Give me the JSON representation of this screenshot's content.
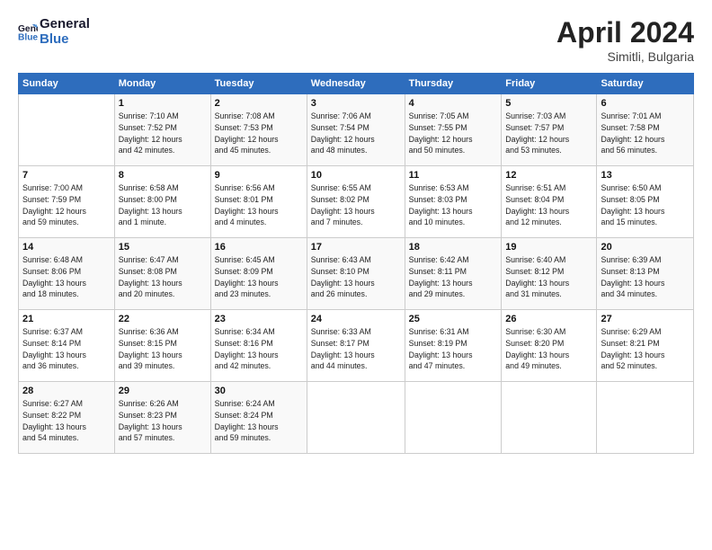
{
  "header": {
    "logo_line1": "General",
    "logo_line2": "Blue",
    "month": "April 2024",
    "location": "Simitli, Bulgaria"
  },
  "weekdays": [
    "Sunday",
    "Monday",
    "Tuesday",
    "Wednesday",
    "Thursday",
    "Friday",
    "Saturday"
  ],
  "weeks": [
    [
      {
        "day": "",
        "info": ""
      },
      {
        "day": "1",
        "info": "Sunrise: 7:10 AM\nSunset: 7:52 PM\nDaylight: 12 hours\nand 42 minutes."
      },
      {
        "day": "2",
        "info": "Sunrise: 7:08 AM\nSunset: 7:53 PM\nDaylight: 12 hours\nand 45 minutes."
      },
      {
        "day": "3",
        "info": "Sunrise: 7:06 AM\nSunset: 7:54 PM\nDaylight: 12 hours\nand 48 minutes."
      },
      {
        "day": "4",
        "info": "Sunrise: 7:05 AM\nSunset: 7:55 PM\nDaylight: 12 hours\nand 50 minutes."
      },
      {
        "day": "5",
        "info": "Sunrise: 7:03 AM\nSunset: 7:57 PM\nDaylight: 12 hours\nand 53 minutes."
      },
      {
        "day": "6",
        "info": "Sunrise: 7:01 AM\nSunset: 7:58 PM\nDaylight: 12 hours\nand 56 minutes."
      }
    ],
    [
      {
        "day": "7",
        "info": "Sunrise: 7:00 AM\nSunset: 7:59 PM\nDaylight: 12 hours\nand 59 minutes."
      },
      {
        "day": "8",
        "info": "Sunrise: 6:58 AM\nSunset: 8:00 PM\nDaylight: 13 hours\nand 1 minute."
      },
      {
        "day": "9",
        "info": "Sunrise: 6:56 AM\nSunset: 8:01 PM\nDaylight: 13 hours\nand 4 minutes."
      },
      {
        "day": "10",
        "info": "Sunrise: 6:55 AM\nSunset: 8:02 PM\nDaylight: 13 hours\nand 7 minutes."
      },
      {
        "day": "11",
        "info": "Sunrise: 6:53 AM\nSunset: 8:03 PM\nDaylight: 13 hours\nand 10 minutes."
      },
      {
        "day": "12",
        "info": "Sunrise: 6:51 AM\nSunset: 8:04 PM\nDaylight: 13 hours\nand 12 minutes."
      },
      {
        "day": "13",
        "info": "Sunrise: 6:50 AM\nSunset: 8:05 PM\nDaylight: 13 hours\nand 15 minutes."
      }
    ],
    [
      {
        "day": "14",
        "info": "Sunrise: 6:48 AM\nSunset: 8:06 PM\nDaylight: 13 hours\nand 18 minutes."
      },
      {
        "day": "15",
        "info": "Sunrise: 6:47 AM\nSunset: 8:08 PM\nDaylight: 13 hours\nand 20 minutes."
      },
      {
        "day": "16",
        "info": "Sunrise: 6:45 AM\nSunset: 8:09 PM\nDaylight: 13 hours\nand 23 minutes."
      },
      {
        "day": "17",
        "info": "Sunrise: 6:43 AM\nSunset: 8:10 PM\nDaylight: 13 hours\nand 26 minutes."
      },
      {
        "day": "18",
        "info": "Sunrise: 6:42 AM\nSunset: 8:11 PM\nDaylight: 13 hours\nand 29 minutes."
      },
      {
        "day": "19",
        "info": "Sunrise: 6:40 AM\nSunset: 8:12 PM\nDaylight: 13 hours\nand 31 minutes."
      },
      {
        "day": "20",
        "info": "Sunrise: 6:39 AM\nSunset: 8:13 PM\nDaylight: 13 hours\nand 34 minutes."
      }
    ],
    [
      {
        "day": "21",
        "info": "Sunrise: 6:37 AM\nSunset: 8:14 PM\nDaylight: 13 hours\nand 36 minutes."
      },
      {
        "day": "22",
        "info": "Sunrise: 6:36 AM\nSunset: 8:15 PM\nDaylight: 13 hours\nand 39 minutes."
      },
      {
        "day": "23",
        "info": "Sunrise: 6:34 AM\nSunset: 8:16 PM\nDaylight: 13 hours\nand 42 minutes."
      },
      {
        "day": "24",
        "info": "Sunrise: 6:33 AM\nSunset: 8:17 PM\nDaylight: 13 hours\nand 44 minutes."
      },
      {
        "day": "25",
        "info": "Sunrise: 6:31 AM\nSunset: 8:19 PM\nDaylight: 13 hours\nand 47 minutes."
      },
      {
        "day": "26",
        "info": "Sunrise: 6:30 AM\nSunset: 8:20 PM\nDaylight: 13 hours\nand 49 minutes."
      },
      {
        "day": "27",
        "info": "Sunrise: 6:29 AM\nSunset: 8:21 PM\nDaylight: 13 hours\nand 52 minutes."
      }
    ],
    [
      {
        "day": "28",
        "info": "Sunrise: 6:27 AM\nSunset: 8:22 PM\nDaylight: 13 hours\nand 54 minutes."
      },
      {
        "day": "29",
        "info": "Sunrise: 6:26 AM\nSunset: 8:23 PM\nDaylight: 13 hours\nand 57 minutes."
      },
      {
        "day": "30",
        "info": "Sunrise: 6:24 AM\nSunset: 8:24 PM\nDaylight: 13 hours\nand 59 minutes."
      },
      {
        "day": "",
        "info": ""
      },
      {
        "day": "",
        "info": ""
      },
      {
        "day": "",
        "info": ""
      },
      {
        "day": "",
        "info": ""
      }
    ]
  ]
}
